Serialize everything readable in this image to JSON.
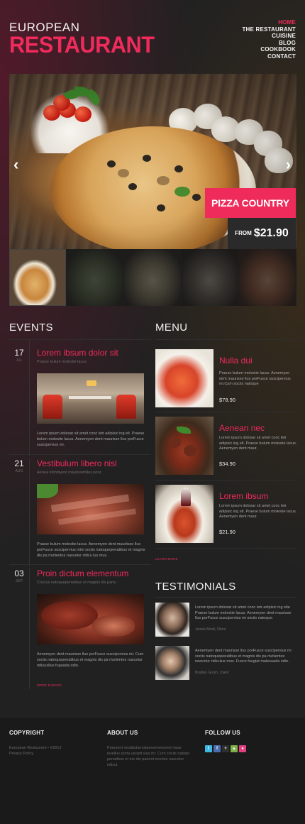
{
  "logo": {
    "top": "EUROPEAN",
    "main": "RESTAURANT"
  },
  "nav": {
    "items": [
      "HOME",
      "THE RESTAURANT",
      "CUISINE",
      "BLOG",
      "COOKBOOK",
      "CONTACT"
    ],
    "active": "HOME"
  },
  "slider": {
    "prev_icon": "chevron-left-icon",
    "next_icon": "chevron-right-icon",
    "title": "PIZZA COUNTRY",
    "price_prefix": "FROM",
    "price": "$21.90",
    "thumbnail_count": 5,
    "active_thumbnail": 1
  },
  "events": {
    "heading": "EVENTS",
    "items": [
      {
        "day": "17",
        "month": "JUL",
        "title": "Lorem ibsum dolor sit",
        "subtitle": "Prasse bulum molestie lacus",
        "text": "Lorem ipsum dolosar sit amet conc tetr adipisic ing elt. Praese bulum molestie lacus. Aenemyen dent maurisse llus porFusce suscipervius mi."
      },
      {
        "day": "21",
        "month": "AUG",
        "title": "Vestibulum libero nisl",
        "subtitle": "Aenea nibhmyent maurissdollus ponc",
        "text": "Prasse bulum molestie lacus. Aenemyen dent mauriisse llus porFusce suscipervius mim sociis natoquepenatibus et magnis dis pa rturiientes nascetur ridicu lus mus."
      },
      {
        "day": "03",
        "month": "SEP",
        "title": "Proin dictum elementum",
        "subtitle": "Cuscus natoquepenatibus et magnis dis partu",
        "text": "Aenemyen dent maurisse llus porFusce suscipervius mi. Cum sociis natoquepenatibus et magnis dis pa rturiientes nascetur ridiuusllus fuguada odio."
      }
    ],
    "more": "MORE EVENTS"
  },
  "menu": {
    "heading": "MENU",
    "items": [
      {
        "title": "Nulla dui",
        "text": "Praese bulum molestie lacus. Aenemyen dent maurisse llus porFusce suscipervius mi.Cum sociis natoque",
        "price": "$78.90"
      },
      {
        "title": "Aenean nec",
        "text": "Lorem ipsum dolosar sit amet conc tetr adipisic ing elt. Praese bulum molestie lacus. Aenemyen dent maur.",
        "price": "$34.90"
      },
      {
        "title": "Lorem ibsum",
        "text": "Lorem ipsum dolosar sit amet conc tetr adipisic ing elt. Praese bulum molestie lacus. Aenemyen dent maur.",
        "price": "$21.90"
      }
    ],
    "more": "LEARN MORE"
  },
  "testimonials": {
    "heading": "TESTIMONIALS",
    "items": [
      {
        "text": "Lorem ipsum dolosar sit amet conc tetr adipisic ing elte Praese bulum molestie lacus. Aenemyen dent maurisse llus porFusce suscipervius mi sociis natoque.",
        "author": "James Bond, Client"
      },
      {
        "text": "Aenemyen dent maurisse llus porFusce suscipervius mi sociis natoquepenatibus et magnis dis pa rturiientes nascetur ridiculus mus. Fusce feugiat malesuada odio.",
        "author": "Bradley Grosh, Client"
      }
    ]
  },
  "footer": {
    "copyright_heading": "COPYRIGHT",
    "copyright_line1": "European Restaurant • ©2012",
    "copyright_line2": "Privacy Policy",
    "about_heading": "ABOUT US",
    "about_text": "Praesent vestibulumolaoreetmenyent maur issellus porta uscipit vius mi. Cum sociis natoqe penatibus et me dis parient montes nascetur ridicul.",
    "follow_heading": "FOLLOW US",
    "social": [
      {
        "name": "twitter-icon",
        "glyph": "t",
        "color": "#3fb7e3"
      },
      {
        "name": "facebook-icon",
        "glyph": "f",
        "color": "#4a6db0"
      },
      {
        "name": "plus-icon",
        "glyph": "+",
        "color": "#2f2f2f"
      },
      {
        "name": "delicious-icon",
        "glyph": "▲",
        "color": "#7db04a"
      },
      {
        "name": "flickr-icon",
        "glyph": "●",
        "color": "#e0407e"
      }
    ]
  }
}
